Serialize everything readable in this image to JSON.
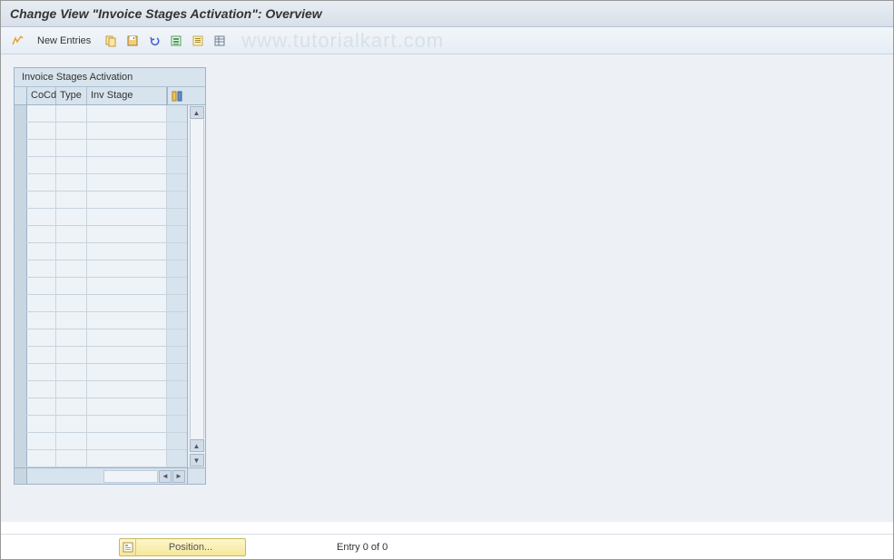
{
  "title": "Change View \"Invoice Stages Activation\": Overview",
  "toolbar": {
    "new_entries_label": "New Entries"
  },
  "watermark": "www.tutorialkart.com",
  "panel": {
    "title": "Invoice Stages Activation",
    "columns": {
      "cocd": "CoCd",
      "type": "Type",
      "inv_stage": "Inv Stage"
    },
    "rows": [
      {
        "cocd": "",
        "type": "",
        "inv_stage": ""
      },
      {
        "cocd": "",
        "type": "",
        "inv_stage": ""
      },
      {
        "cocd": "",
        "type": "",
        "inv_stage": ""
      },
      {
        "cocd": "",
        "type": "",
        "inv_stage": ""
      },
      {
        "cocd": "",
        "type": "",
        "inv_stage": ""
      },
      {
        "cocd": "",
        "type": "",
        "inv_stage": ""
      },
      {
        "cocd": "",
        "type": "",
        "inv_stage": ""
      },
      {
        "cocd": "",
        "type": "",
        "inv_stage": ""
      },
      {
        "cocd": "",
        "type": "",
        "inv_stage": ""
      },
      {
        "cocd": "",
        "type": "",
        "inv_stage": ""
      },
      {
        "cocd": "",
        "type": "",
        "inv_stage": ""
      },
      {
        "cocd": "",
        "type": "",
        "inv_stage": ""
      },
      {
        "cocd": "",
        "type": "",
        "inv_stage": ""
      },
      {
        "cocd": "",
        "type": "",
        "inv_stage": ""
      },
      {
        "cocd": "",
        "type": "",
        "inv_stage": ""
      },
      {
        "cocd": "",
        "type": "",
        "inv_stage": ""
      },
      {
        "cocd": "",
        "type": "",
        "inv_stage": ""
      },
      {
        "cocd": "",
        "type": "",
        "inv_stage": ""
      },
      {
        "cocd": "",
        "type": "",
        "inv_stage": ""
      },
      {
        "cocd": "",
        "type": "",
        "inv_stage": ""
      },
      {
        "cocd": "",
        "type": "",
        "inv_stage": ""
      }
    ]
  },
  "footer": {
    "position_label": "Position...",
    "entry_text": "Entry 0 of 0"
  }
}
